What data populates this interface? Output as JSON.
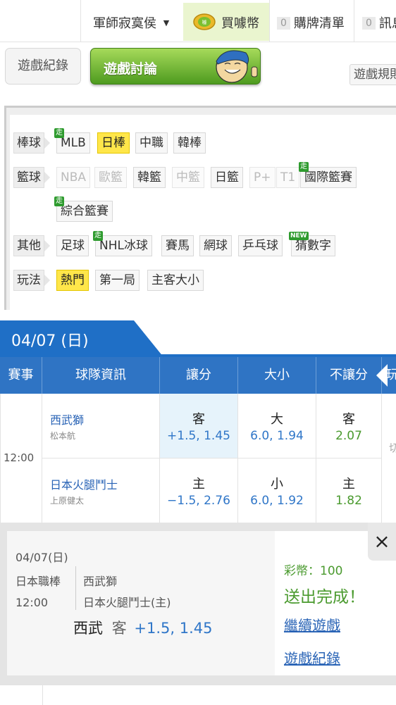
{
  "nav": {
    "user": "軍師寂寞侯",
    "buy_coins": "買噱幣",
    "ticket_count": "0",
    "ticket_list": "購牌清單",
    "msg_count": "0",
    "messages": "訊息"
  },
  "tabs": {
    "record": "遊戲紀錄",
    "discuss": "遊戲討論",
    "rules": "遊戲規則"
  },
  "filters": {
    "baseball_label": "棒球",
    "baseball": [
      "MLB",
      "日棒",
      "中職",
      "韓棒"
    ],
    "basketball_label": "籃球",
    "basketball": [
      "NBA",
      "歐籃",
      "韓籃",
      "中籃",
      "日籃",
      "P+",
      "T1",
      "國際籃賽",
      "綜合籃賽"
    ],
    "other_label": "其他",
    "other": [
      "足球",
      "NHL冰球",
      "賽馬",
      "網球",
      "乒乓球",
      "猜數字"
    ],
    "play_label": "玩法",
    "play": [
      "熱門",
      "第一局",
      "主客大小"
    ],
    "walk_tag": "走",
    "new_tag": "NEW"
  },
  "date": "04/07 (日)",
  "table": {
    "headers": [
      "賽事",
      "球隊資訊",
      "讓分",
      "大小",
      "不讓分",
      "玩"
    ],
    "time": "12:00",
    "extra_cell": "切",
    "away": {
      "team": "西武獅",
      "pitcher": "松本航",
      "spread_side": "客",
      "spread": "+1.5, 1.45",
      "total_side": "大",
      "total": "6.0, 1.94",
      "ml_side": "客",
      "ml": "2.07"
    },
    "home": {
      "team": "日本火腿鬥士",
      "pitcher": "上原健太",
      "spread_side": "主",
      "spread": "−1.5, 2.76",
      "total_side": "小",
      "total": "6.0, 1.92",
      "ml_side": "主",
      "ml": "1.82"
    }
  },
  "popup": {
    "date": "04/07(日)",
    "league": "日本職棒",
    "time": "12:00",
    "team_away": "西武獅",
    "team_home": "日本火腿鬥士(主)",
    "pick_team": "西武",
    "pick_side": "客",
    "pick_odds": "+1.5, 1.45",
    "coins": "彩幣：100",
    "success": "送出完成！",
    "continue": "繼續遊戲",
    "record": "遊戲紀錄",
    "close": "×"
  },
  "colors": {
    "header_blue": "#2f74c4",
    "selected_yellow": "#ffe64a",
    "success_green": "#4a9a2e",
    "link_blue": "#2a64b6"
  }
}
